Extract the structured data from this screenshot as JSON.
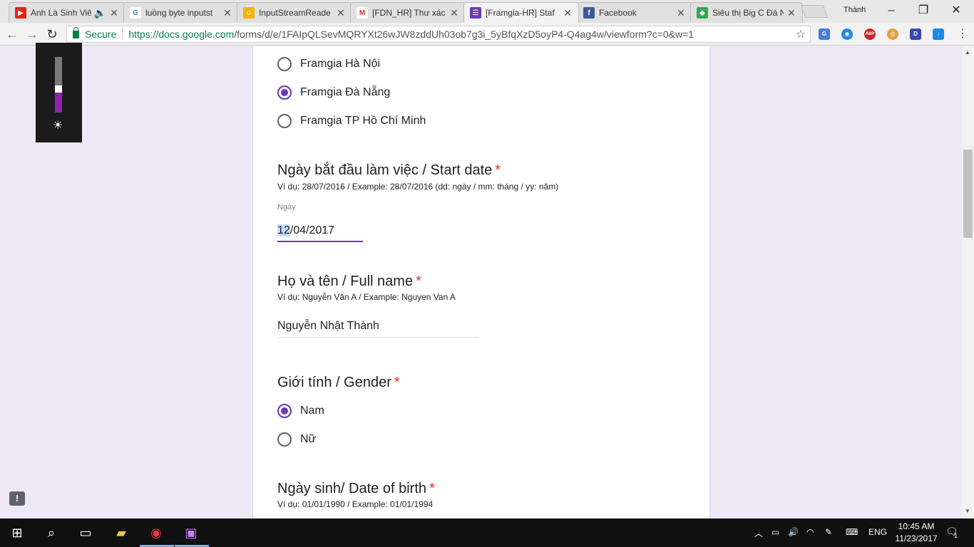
{
  "browser": {
    "tabs": [
      {
        "title": "Anh Là Sinh Viê",
        "icon": "youtube-icon",
        "color": "#e62117",
        "glyph": "▶"
      },
      {
        "title": "luồng byte inputst",
        "icon": "google-icon",
        "color": "#4285f4",
        "glyph": "G"
      },
      {
        "title": "InputStreamReade",
        "icon": "avatar-icon",
        "color": "#f4b400",
        "glyph": "☺"
      },
      {
        "title": "[FDN_HR] Thư xác",
        "icon": "gmail-icon",
        "color": "#d93025",
        "glyph": "M"
      },
      {
        "title": "[Framgia-HR] Staf",
        "icon": "google-forms-icon",
        "color": "#673ab7",
        "glyph": "☰"
      },
      {
        "title": "Facebook",
        "icon": "facebook-icon",
        "color": "#3b5998",
        "glyph": "f"
      },
      {
        "title": "Siêu thị Big C Đà N",
        "icon": "maps-icon",
        "color": "#34a853",
        "glyph": "◆"
      }
    ],
    "user_name": "Thành",
    "secure_label": "Secure",
    "url_host": "https://docs.google.com",
    "url_path": "/forms/d/e/1FAIpQLSevMQRYXt26wJW8zddUh03ob7g3i_5yBfqXzD5oyP4-Q4ag4w/viewform?c=0&w=1",
    "extensions": [
      {
        "name": "translate-extension-icon",
        "color": "#4a7bd8",
        "glyph": "G"
      },
      {
        "name": "globe-extension-icon",
        "color": "#1e88e5",
        "glyph": "◉"
      },
      {
        "name": "adblock-plus-icon",
        "color": "#c62828",
        "glyph": "ABP"
      },
      {
        "name": "coin-extension-icon",
        "color": "#e0a040",
        "glyph": "◎"
      },
      {
        "name": "d-extension-icon",
        "color": "#3949ab",
        "glyph": "D"
      },
      {
        "name": "save-extension-icon",
        "color": "#1e88e5",
        "glyph": "↓"
      }
    ]
  },
  "form": {
    "branch_options": [
      {
        "label": "Framgia Hà Nội",
        "selected": false
      },
      {
        "label": "Framgia Đà Nẵng",
        "selected": true
      },
      {
        "label": "Framgia TP Hồ Chí Minh",
        "selected": false
      }
    ],
    "start_date": {
      "title": "Ngày bắt đầu làm việc / Start date",
      "required_mark": "*",
      "description": "Ví dụ: 28/07/2016 / Example: 28/07/2016 (dd: ngày / mm: tháng / yy: năm)",
      "field_caption": "Ngày",
      "value_day": "12",
      "value_rest": "/04/2017"
    },
    "full_name": {
      "title": "Họ và tên / Full name",
      "required_mark": "*",
      "description": "Ví dụ: Nguyễn Văn A / Example: Nguyen Van A",
      "value": "Nguyễn Nhật Thành"
    },
    "gender": {
      "title": "Giới tính / Gender",
      "required_mark": "*",
      "options": [
        {
          "label": "Nam",
          "selected": true
        },
        {
          "label": "Nữ",
          "selected": false
        }
      ]
    },
    "date_of_birth": {
      "title": "Ngày sinh/ Date of birth",
      "required_mark": "*",
      "description": "Ví dụ: 01/01/1990 / Example: 01/01/1994"
    }
  },
  "overlay": {
    "brightness_level": 0.36,
    "feedback_glyph": "!"
  },
  "taskbar": {
    "language": "ENG",
    "time": "10:45 AM",
    "date": "11/23/2017",
    "notification_count": "1"
  }
}
